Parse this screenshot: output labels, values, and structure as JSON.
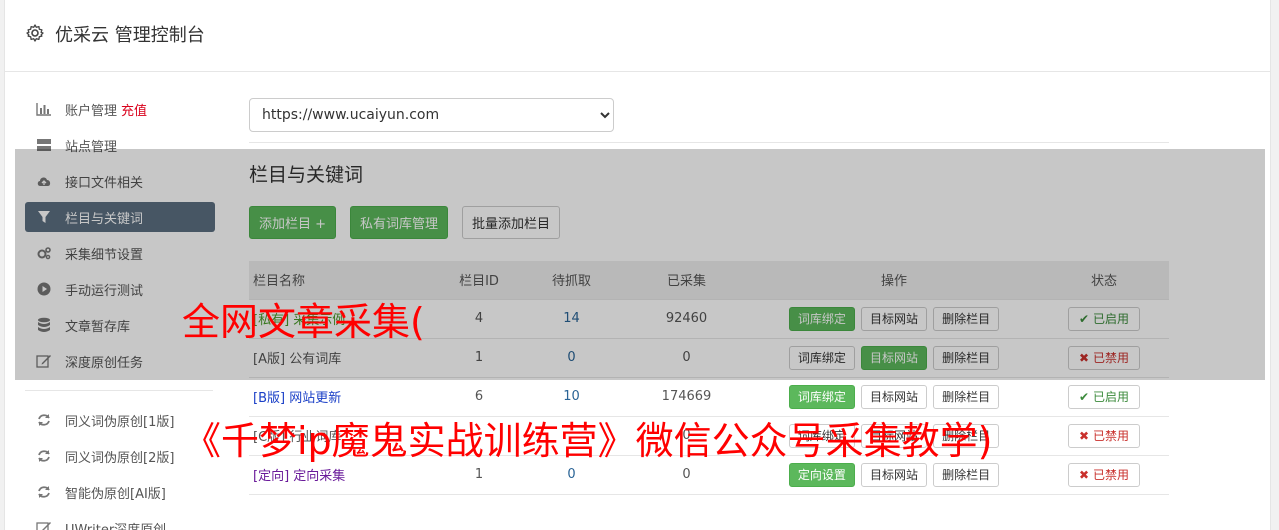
{
  "header": {
    "title": "优采云 管理控制台"
  },
  "sidebar": {
    "items": [
      {
        "label": "账户管理",
        "extra": "充值",
        "icon": "bar-chart-icon"
      },
      {
        "label": "站点管理",
        "icon": "server-icon"
      },
      {
        "label": "接口文件相关",
        "icon": "cloud-upload-icon"
      },
      {
        "label": "栏目与关键词",
        "icon": "filter-icon",
        "active": true
      },
      {
        "label": "采集细节设置",
        "icon": "gears-icon"
      },
      {
        "label": "手动运行测试",
        "icon": "play-circle-icon"
      },
      {
        "label": "文章暂存库",
        "icon": "database-icon"
      },
      {
        "label": "深度原创任务",
        "icon": "edit-icon"
      }
    ],
    "items2": [
      {
        "label": "同义词伪原创[1版]",
        "icon": "refresh-icon"
      },
      {
        "label": "同义词伪原创[2版]",
        "icon": "refresh-icon"
      },
      {
        "label": "智能伪原创[AI版]",
        "icon": "refresh-icon"
      },
      {
        "label": "UWriter深度原创",
        "icon": "edit-icon"
      }
    ]
  },
  "main": {
    "site_select": "https://www.ucaiyun.com",
    "section_title": "栏目与关键词",
    "toolbar": {
      "add": "添加栏目 +",
      "private_lib": "私有词库管理",
      "batch_add": "批量添加栏目"
    },
    "table": {
      "headers": [
        "栏目名称",
        "栏目ID",
        "待抓取",
        "已采集",
        "操作",
        "状态"
      ],
      "rows": [
        {
          "tag": "[私有]",
          "name": "采集示例",
          "id": "4",
          "pending": "14",
          "collected": "92460",
          "b1": "词库绑定",
          "b2": "目标网站",
          "b3": "删除栏目",
          "status": "已启用"
        },
        {
          "tag": "[A版]",
          "name": "公有词库",
          "id": "1",
          "pending": "0",
          "collected": "0",
          "b1": "词库绑定",
          "b2": "目标网站",
          "b3": "删除栏目",
          "status": "已禁用"
        },
        {
          "tag": "[B版]",
          "name": "网站更新",
          "id": "6",
          "pending": "10",
          "collected": "174669",
          "b1": "词库绑定",
          "b2": "目标网站",
          "b3": "删除栏目",
          "status": "已启用"
        },
        {
          "tag": "[C版]",
          "name": "行业词库",
          "id": "",
          "pending": "",
          "collected": "0",
          "b1": "词库绑定",
          "b2": "目标网站",
          "b3": "删除栏目",
          "status": "已禁用"
        },
        {
          "tag": "[定向]",
          "name": "定向采集",
          "id": "1",
          "pending": "0",
          "collected": "0",
          "b1": "定向设置",
          "b2": "目标网站",
          "b3": "删除栏目",
          "status": "已禁用"
        }
      ]
    }
  },
  "watermark": {
    "line1": "全网文章采集(",
    "line2": "《千梦ip魔鬼实战训练营》微信公众号采集教学)"
  },
  "colors": {
    "accent_green": "#5cb85c",
    "active_nav": "#5b6f80",
    "danger": "#d9001b",
    "watermark": "#ff0000"
  }
}
